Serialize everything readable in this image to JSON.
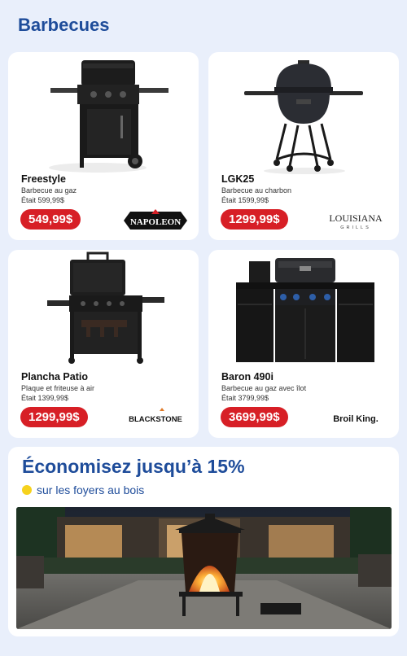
{
  "section": {
    "title": "Barbecues"
  },
  "products": [
    {
      "name": "Freestyle",
      "desc": "Barbecue au gaz",
      "was": "Était 599,99$",
      "price": "549,99$",
      "brand": "NAPOLEON",
      "icon": "gas-grill-icon"
    },
    {
      "name": "LGK25",
      "desc": "Barbecue au charbon",
      "was": "Était 1599,99$",
      "price": "1299,99$",
      "brand": "LOUISIANA",
      "brand_sub": "GRILLS",
      "icon": "kamado-grill-icon"
    },
    {
      "name": "Plancha Patio",
      "desc": "Plaque et friteuse à air",
      "was": "Était 1399,99$",
      "price": "1299,99$",
      "brand": "BLACKSTONE",
      "icon": "griddle-icon"
    },
    {
      "name": "Baron 490i",
      "desc": "Barbecue au gaz avec îlot",
      "was": "Était 3799,99$",
      "price": "3699,99$",
      "brand": "Broil King.",
      "icon": "outdoor-kitchen-icon"
    }
  ],
  "promo": {
    "title": "Économisez jusqu’à 15%",
    "subtitle": "sur les foyers au bois",
    "icon": "fire-pit-photo"
  },
  "colors": {
    "accent": "#1e4c9a",
    "price": "#d71f26",
    "bullet": "#f6d21d",
    "background": "#e9effb"
  }
}
